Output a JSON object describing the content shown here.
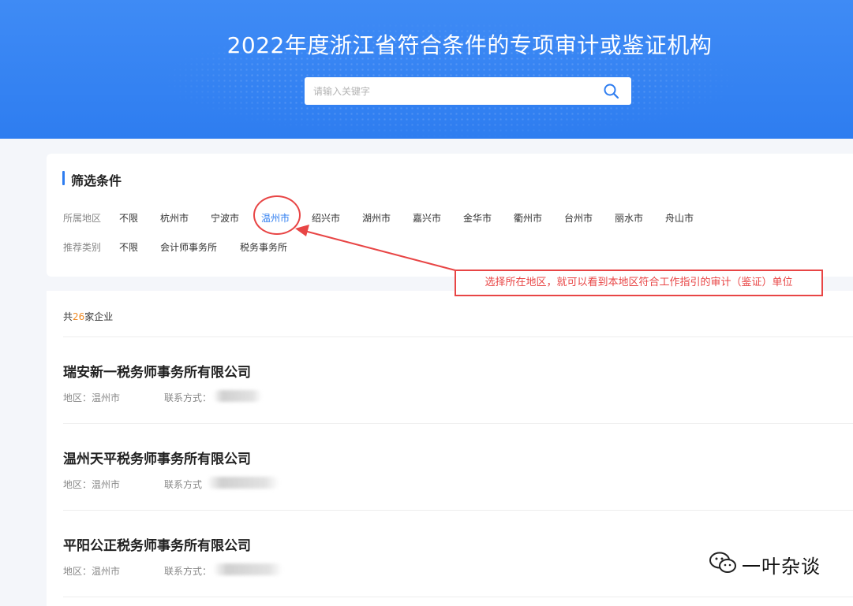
{
  "hero": {
    "title": "2022年度浙江省符合条件的专项审计或鉴证机构",
    "search_placeholder": "请输入关键字",
    "search_icon": "search-icon"
  },
  "filter": {
    "title": "筛选条件",
    "region_label": "所属地区",
    "regions": [
      "不限",
      "杭州市",
      "宁波市",
      "温州市",
      "绍兴市",
      "湖州市",
      "嘉兴市",
      "金华市",
      "衢州市",
      "台州市",
      "丽水市",
      "舟山市"
    ],
    "region_selected": "温州市",
    "category_label": "推荐类别",
    "categories": [
      "不限",
      "会计师事务所",
      "税务事务所"
    ]
  },
  "annotation": {
    "callout_text": "选择所在地区，就可以看到本地区符合工作指引的审计（鉴证）单位",
    "colors": {
      "annotation_red": "#e84545"
    }
  },
  "results": {
    "count_prefix": "共",
    "count": "26",
    "count_suffix": "家企业",
    "companies": [
      {
        "name": "瑞安新一税务师事务所有限公司",
        "region_text": "地区：温州市",
        "contact_text": "联系方式："
      },
      {
        "name": "温州天平税务师事务所有限公司",
        "region_text": "地区：温州市",
        "contact_text": "联系方式"
      },
      {
        "name": "平阳公正税务师事务所有限公司",
        "region_text": "地区：温州市",
        "contact_text": "联系方式："
      }
    ]
  },
  "watermark": {
    "text": "一叶杂谈",
    "icon": "wechat-icon"
  },
  "colors": {
    "brand_blue": "#2e7df0",
    "count_orange": "#f08a24"
  }
}
